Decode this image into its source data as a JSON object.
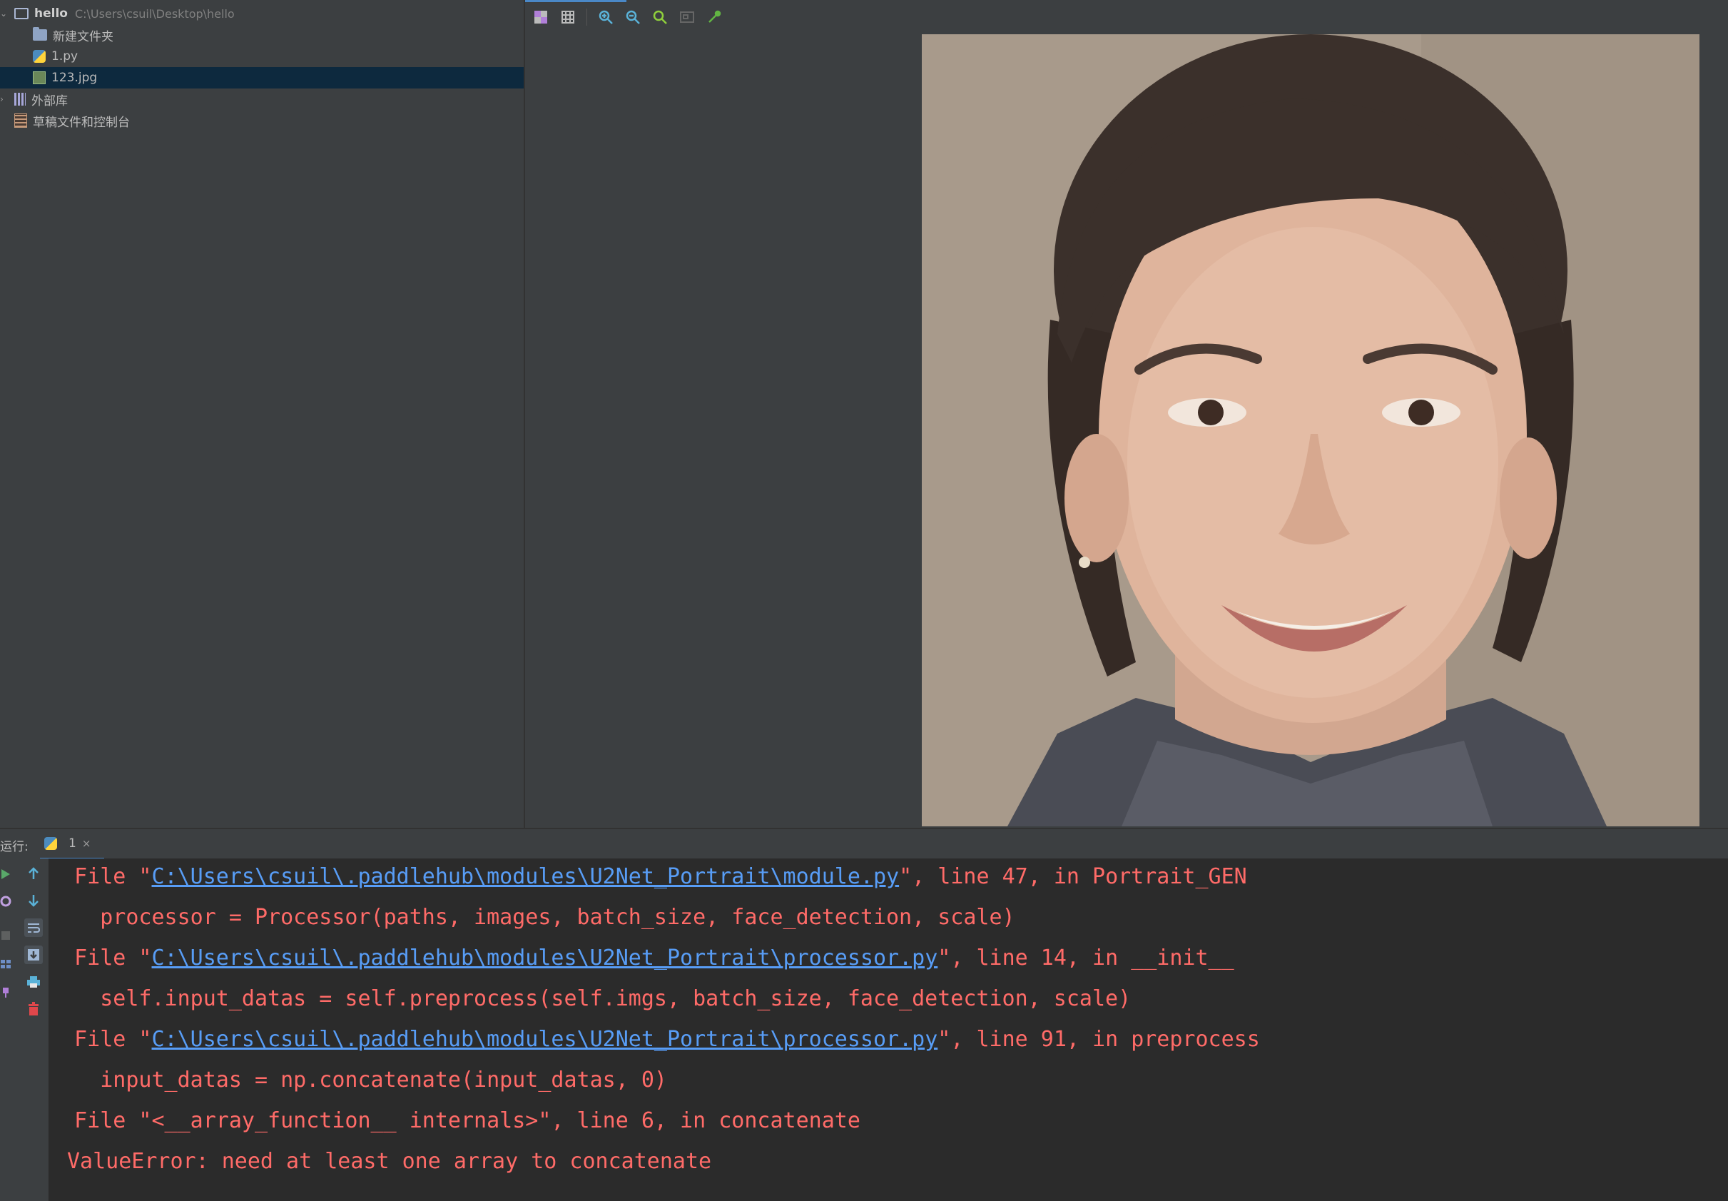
{
  "project_tree": {
    "root": {
      "name": "hello",
      "path": "C:\\Users\\csuil\\Desktop\\hello"
    },
    "items": [
      {
        "label": "新建文件夹"
      },
      {
        "label": "1.py"
      },
      {
        "label": "123.jpg"
      }
    ],
    "external_libraries": "外部库",
    "scratches": "草稿文件和控制台"
  },
  "image_toolbar": {
    "icons": [
      "chessboard-icon",
      "grid-icon",
      "zoom-in-icon",
      "zoom-out-icon",
      "actual-size-icon",
      "fit-window-icon",
      "color-picker-icon"
    ]
  },
  "run_panel": {
    "label": "运行:",
    "tab": {
      "label": "1",
      "close": "×"
    }
  },
  "console": {
    "lines": [
      {
        "pre": "  File \"",
        "link": "C:\\Users\\csuil\\.paddlehub\\modules\\U2Net_Portrait\\module.py",
        "post": "\", line 47, in Portrait_GEN"
      },
      {
        "text": "    processor = Processor(paths, images, batch_size, face_detection, scale)"
      },
      {
        "pre": "  File \"",
        "link": "C:\\Users\\csuil\\.paddlehub\\modules\\U2Net_Portrait\\processor.py",
        "post": "\", line 14, in __init__"
      },
      {
        "text": "    self.input_datas = self.preprocess(self.imgs, batch_size, face_detection, scale)"
      },
      {
        "pre": "  File \"",
        "link": "C:\\Users\\csuil\\.paddlehub\\modules\\U2Net_Portrait\\processor.py",
        "post": "\", line 91, in preprocess"
      },
      {
        "text": "    input_datas = np.concatenate(input_datas, 0)"
      },
      {
        "text": "  File \"<__array_function__ internals>\", line 6, in concatenate"
      },
      {
        "text": "ValueError: need at least one array to concatenate"
      }
    ]
  },
  "colors": {
    "error": "#ff6b68",
    "link": "#589df6",
    "selection": "#0d293e",
    "console_bg": "#2b2b2b",
    "panel_bg": "#3c3f41"
  }
}
